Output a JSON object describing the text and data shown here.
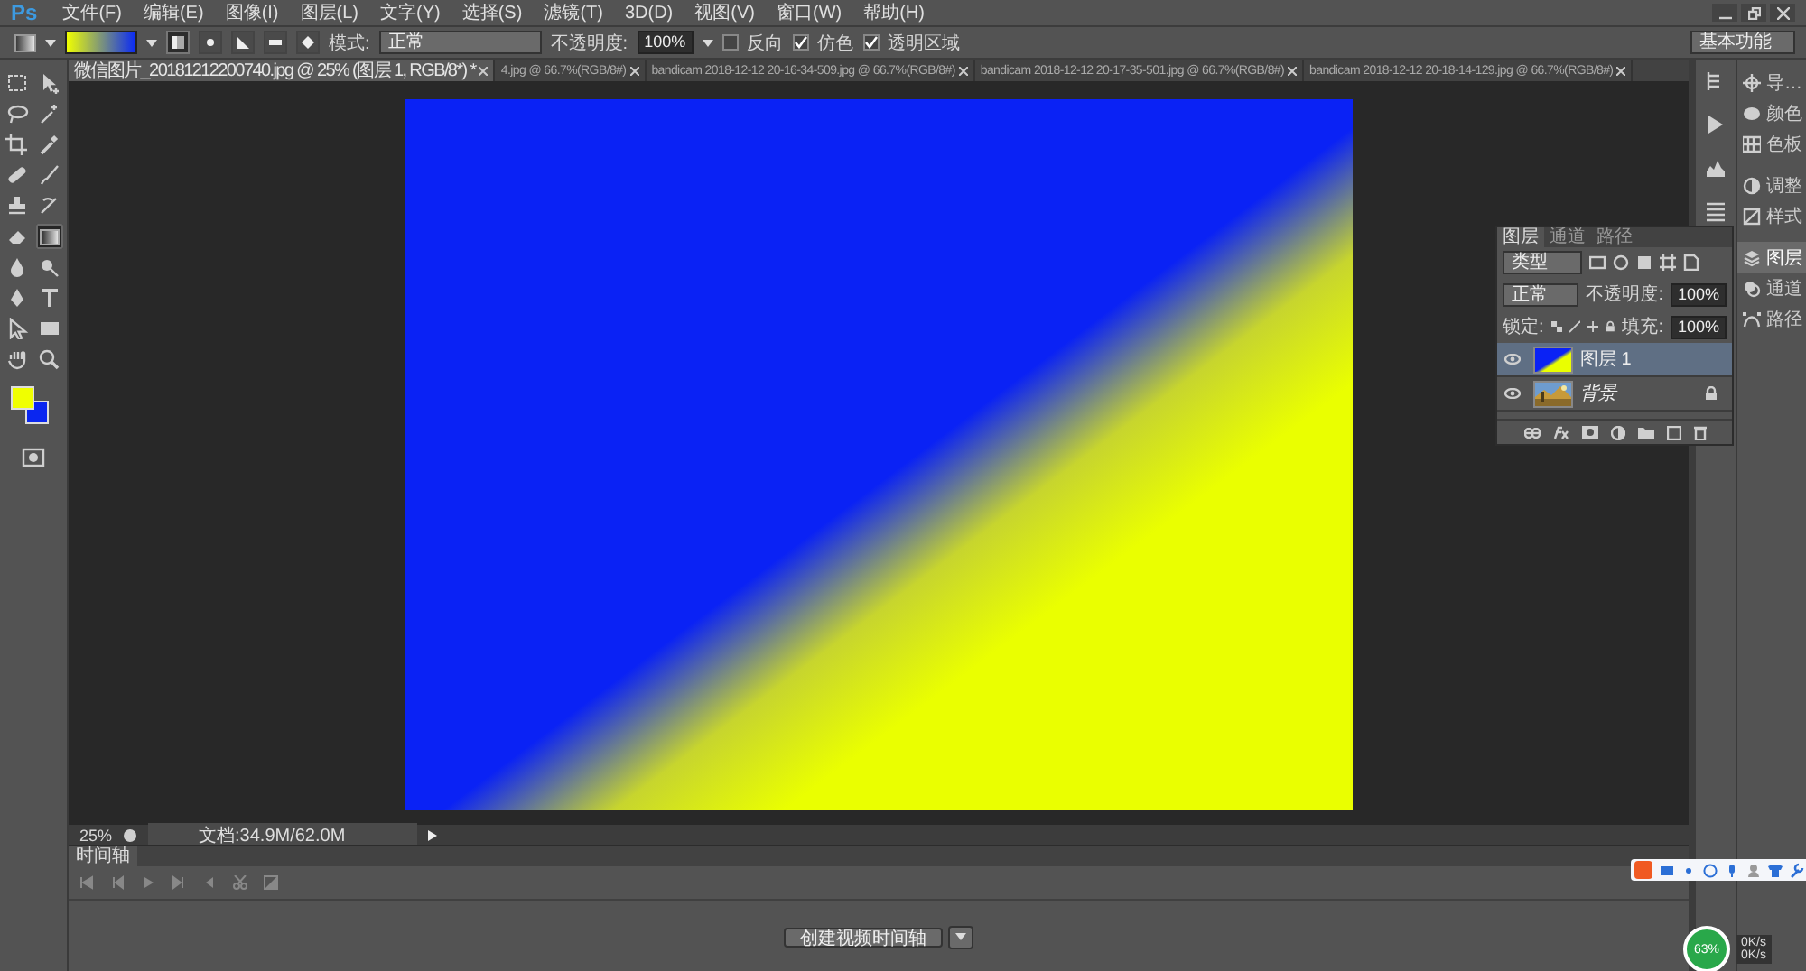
{
  "app_logo": "Ps",
  "menu": [
    "文件(F)",
    "编辑(E)",
    "图像(I)",
    "图层(L)",
    "文字(Y)",
    "选择(S)",
    "滤镜(T)",
    "3D(D)",
    "视图(V)",
    "窗口(W)",
    "帮助(H)"
  ],
  "options_bar": {
    "gradient_types": [
      {
        "selected": true
      },
      {
        "selected": false
      },
      {
        "selected": false
      },
      {
        "selected": false
      },
      {
        "selected": false
      }
    ],
    "mode_label": "模式:",
    "mode": "正常",
    "opacity_label": "不透明度:",
    "opacity": "100%",
    "checkboxes": [
      {
        "label": "反向",
        "checked": false
      },
      {
        "label": "仿色",
        "checked": true
      },
      {
        "label": "透明区域",
        "checked": true
      }
    ],
    "workspace": "基本功能"
  },
  "tools": [
    {
      "selected": false
    },
    {
      "selected": false
    },
    {
      "selected": false
    },
    {
      "selected": false
    },
    {
      "selected": false
    },
    {
      "selected": false
    },
    {
      "selected": false
    },
    {
      "selected": false
    },
    {
      "selected": false
    },
    {
      "selected": false
    },
    {
      "selected": false
    },
    {
      "selected": true
    },
    {
      "selected": false
    },
    {
      "selected": false
    },
    {
      "selected": false
    },
    {
      "selected": false
    },
    {
      "selected": false
    },
    {
      "selected": false
    },
    {
      "selected": false
    },
    {
      "selected": false
    }
  ],
  "document_tabs": [
    {
      "label": "微信图片_20181212200740.jpg @ 25% (图层 1, RGB/8*) *",
      "selected": true
    },
    {
      "label": "4.jpg @ 66.7%(RGB/8#)",
      "selected": false
    },
    {
      "label": "bandicam 2018-12-12 20-16-34-509.jpg @ 66.7%(RGB/8#)",
      "selected": false
    },
    {
      "label": "bandicam 2018-12-12 20-17-35-501.jpg @ 66.7%(RGB/8#)",
      "selected": false
    },
    {
      "label": "bandicam 2018-12-12 20-18-14-129.jpg @ 66.7%(RGB/8#)",
      "selected": false
    }
  ],
  "status_bar": {
    "zoom": "25%",
    "doc_info": "文档:34.9M/62.0M"
  },
  "timeline": {
    "tab": "时间轴",
    "create_button": "创建视频时间轴"
  },
  "dock": {
    "items": [
      {
        "label": "导…",
        "selected": false
      },
      {
        "label": "颜色",
        "selected": false
      },
      {
        "label": "色板",
        "selected": false
      },
      {
        "label": "调整",
        "selected": false
      },
      {
        "label": "样式",
        "selected": false
      },
      {
        "label": "图层",
        "selected": true
      },
      {
        "label": "通道",
        "selected": false
      },
      {
        "label": "路径",
        "selected": false
      }
    ]
  },
  "layers_panel": {
    "tabs": [
      {
        "label": "图层",
        "selected": true
      },
      {
        "label": "通道",
        "selected": false
      },
      {
        "label": "路径",
        "selected": false
      }
    ],
    "filter": "类型",
    "blend_mode": "正常",
    "opacity_label": "不透明度:",
    "opacity": "100%",
    "lock_label": "锁定:",
    "fill_label": "填充:",
    "fill": "100%",
    "layers": [
      {
        "name": "图层 1",
        "kind": "gradient",
        "visible": true,
        "selected": true,
        "locked": false
      },
      {
        "name": "背景",
        "visible": true,
        "selected": false,
        "locked": true
      }
    ]
  },
  "network_meter": {
    "usage": "63%",
    "upload": "0K/s",
    "download": "0K/s"
  }
}
